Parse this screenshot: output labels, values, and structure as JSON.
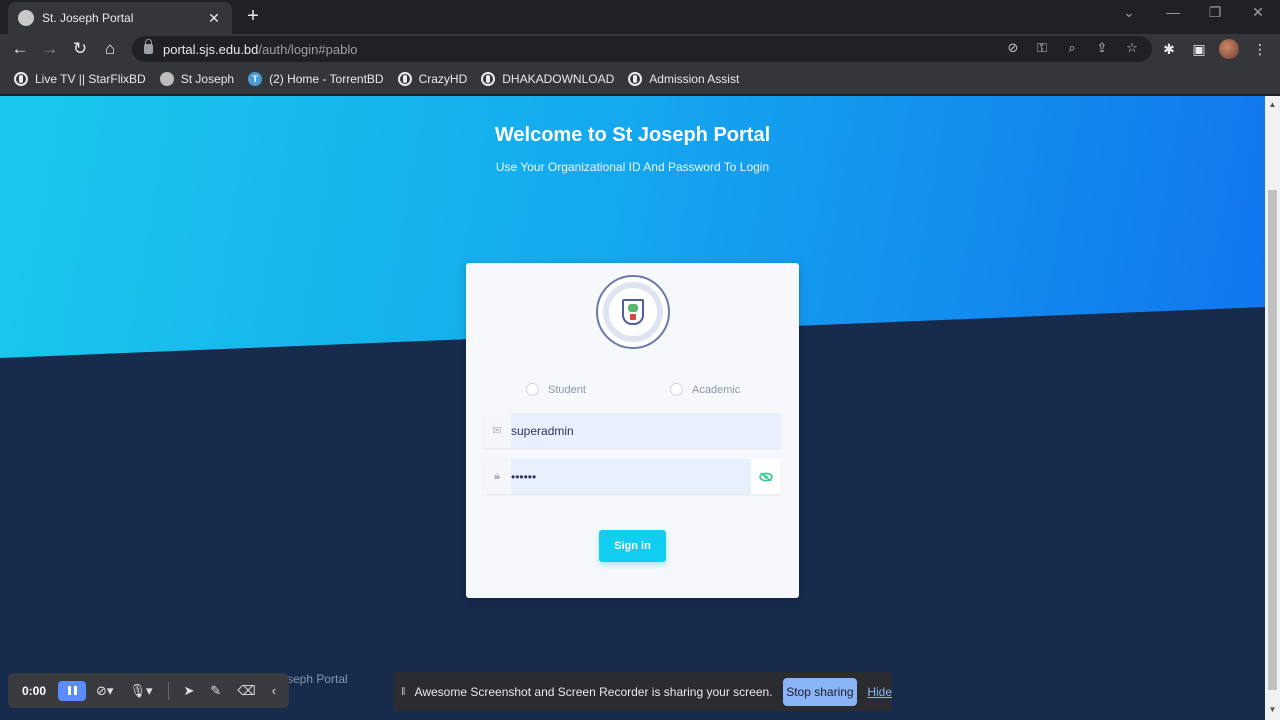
{
  "browser": {
    "tab_title": "St. Joseph Portal",
    "url_host": "portal.sjs.edu.bd",
    "url_path": "/auth/login#pablo",
    "bookmarks": [
      {
        "label": "Live TV || StarFlixBD",
        "icon": "globe-icon"
      },
      {
        "label": "St Joseph",
        "icon": "sjs-favicon-icon"
      },
      {
        "label": "(2) Home - TorrentBD",
        "icon": "torrentbd-icon"
      },
      {
        "label": "CrazyHD",
        "icon": "globe-icon"
      },
      {
        "label": "DHAKADOWNLOAD",
        "icon": "globe-icon"
      },
      {
        "label": "Admission Assist",
        "icon": "globe-icon"
      }
    ]
  },
  "page": {
    "heading": "Welcome to St Joseph Portal",
    "subheading": "Use Your Organizational ID And Password To Login",
    "footer_partial": "seph Portal"
  },
  "login": {
    "roles": [
      "Student",
      "Academic"
    ],
    "username_value": "superadmin",
    "password_value": "••••••",
    "sign_in_label": "Sign in"
  },
  "recorder": {
    "time": "0:00",
    "share_message": "Awesome Screenshot and Screen Recorder is sharing your screen.",
    "stop_label": "Stop sharing",
    "hide_label": "Hide"
  },
  "colors": {
    "accent": "#11cdef",
    "dark_bg": "#172b4d",
    "gradient_start": "#1ac8ec",
    "gradient_end": "#1171ef"
  }
}
